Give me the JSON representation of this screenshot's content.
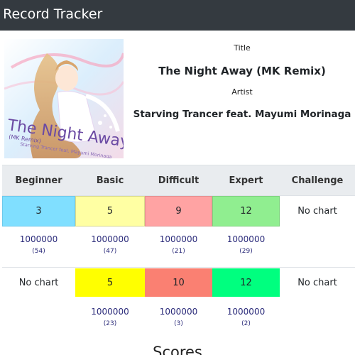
{
  "navbar": {
    "brand": "d Record Tracker"
  },
  "song": {
    "title_label": "Title",
    "title": "The Night Away (MK Remix)",
    "artist_label": "Artist",
    "artist": "Starving Trancer feat. Mayumi Morinaga"
  },
  "jacket": {
    "text_main": "The Night Away",
    "text_sub": "(MK Remix)",
    "text_artist": "Starving Trancer feat. Mayumi Morinaga"
  },
  "difficulties": [
    "Beginner",
    "Basic",
    "Difficult",
    "Expert",
    "Challenge"
  ],
  "single": {
    "levels": [
      "3",
      "5",
      "9",
      "12",
      "No chart"
    ],
    "scores": [
      {
        "score": "1000000",
        "count": "(54)"
      },
      {
        "score": "1000000",
        "count": "(47)"
      },
      {
        "score": "1000000",
        "count": "(21)"
      },
      {
        "score": "1000000",
        "count": "(29)"
      }
    ]
  },
  "double": {
    "levels": [
      "No chart",
      "5",
      "10",
      "12",
      "No chart"
    ],
    "scores": [
      {
        "score": "1000000",
        "count": "(23)"
      },
      {
        "score": "1000000",
        "count": "(3)"
      },
      {
        "score": "1000000",
        "count": "(2)"
      }
    ]
  },
  "scores_heading": "Scores",
  "colors": {
    "navbar": "#343a40",
    "single_beginner": "#80dfff",
    "single_basic": "#ffffa3",
    "single_difficult": "#ffa3a3",
    "single_expert": "#90ee90",
    "double_basic": "#ffff00",
    "double_difficult": "#fa8072",
    "double_expert": "#00ff7f"
  }
}
